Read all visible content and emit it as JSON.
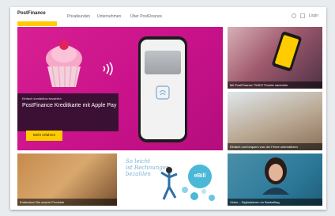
{
  "header": {
    "brand": "PostFinance",
    "nav": [
      "Privatkunden",
      "Unternehmen",
      "Über PostFinance"
    ],
    "tools": [
      "Login"
    ]
  },
  "hero": {
    "kicker": "Einfach kontaktlos bezahlen",
    "title": "PostFinance Kreditkarte mit Apple Pay",
    "button": "Mehr erfahren"
  },
  "tiles": {
    "top_right": "Mit PostFinance TWINT Punkte sammeln",
    "mid_right": "Einfach und bequem von der Ferne unterstützen",
    "bottom_left": "Entdecken Sie unsere Produkte",
    "bottom_center": {
      "text_line1": "So leicht",
      "text_line2": "ist Rechnungen",
      "text_line3": "bezahlen",
      "badge": "eBill"
    },
    "bottom_right": "Video – Digitalisieren im Bankalltag"
  },
  "colors": {
    "brand_yellow": "#ffcc00",
    "hero_magenta": "#d81f93"
  }
}
